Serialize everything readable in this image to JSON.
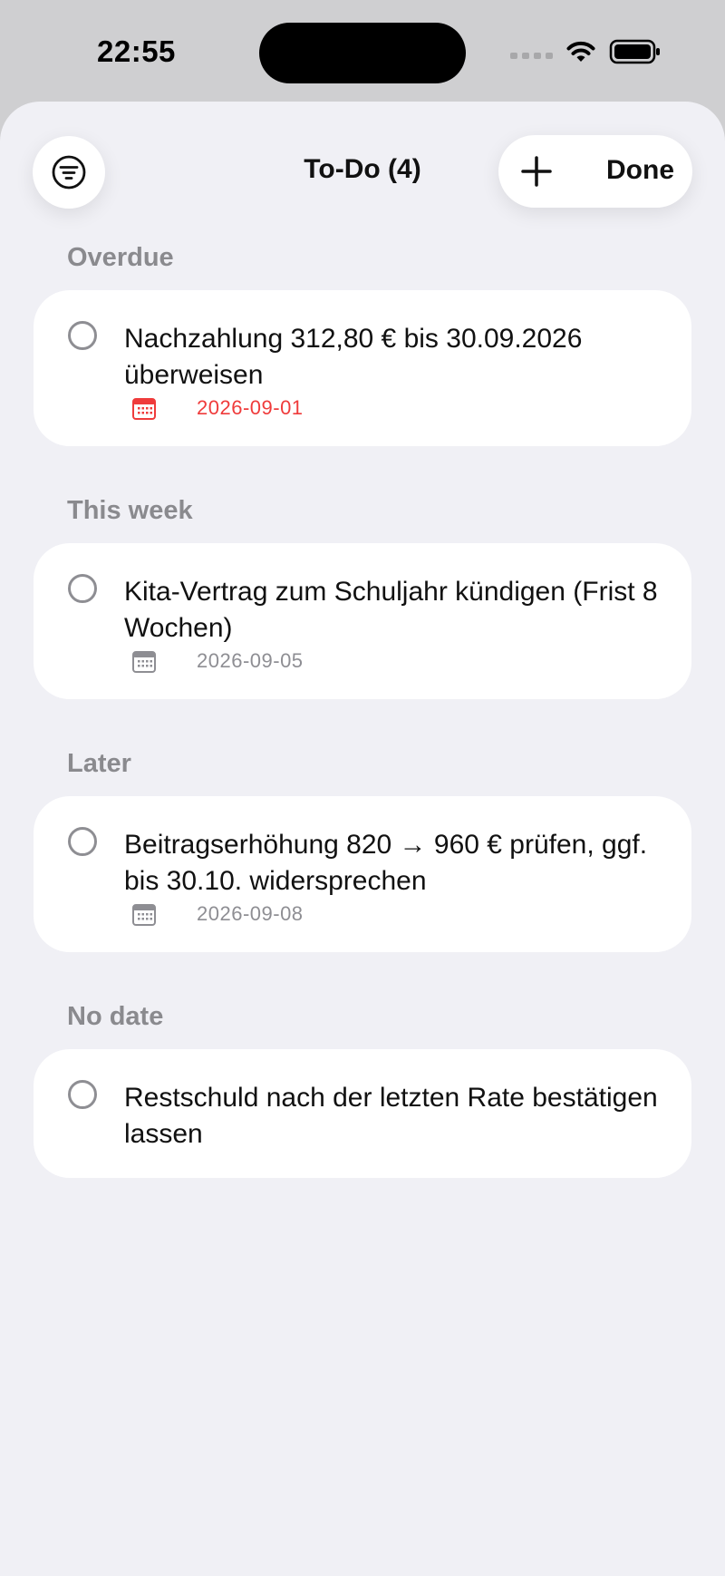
{
  "status_bar": {
    "time": "22:55"
  },
  "nav": {
    "title": "To-Do (4)",
    "done_label": "Done",
    "filter_icon": "filter-lines-icon",
    "add_icon": "plus-icon"
  },
  "colors": {
    "overdue": "#ef3b3b",
    "muted": "#8e8e93",
    "background": "#f0f0f5"
  },
  "sections": [
    {
      "header": "Overdue",
      "task": {
        "title": "Nachzahlung 312,80 € bis 30.09.2026 überweisen",
        "date": "2026-09-01",
        "overdue": true
      }
    },
    {
      "header": "This week",
      "task": {
        "title": "Kita-Vertrag zum Schuljahr kündigen (Frist 8 Wochen)",
        "date": "2026-09-05",
        "overdue": false
      }
    },
    {
      "header": "Later",
      "task": {
        "title": "Beitragserhöhung 820 → 960 € prüfen, ggf. bis 30.10. widersprechen",
        "date": "2026-09-08",
        "overdue": false
      }
    },
    {
      "header": "No date",
      "task": {
        "title": "Restschuld nach der letzten Rate bestätigen lassen",
        "date": null,
        "overdue": false
      }
    }
  ]
}
